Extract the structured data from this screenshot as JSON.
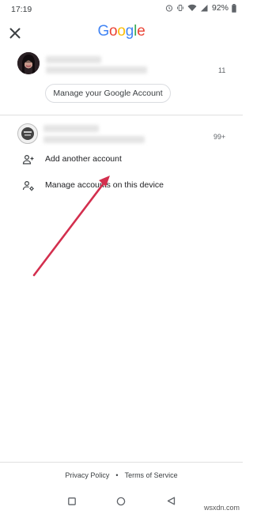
{
  "status_bar": {
    "time": "17:19",
    "battery": "92%"
  },
  "header": {
    "logo": [
      "G",
      "o",
      "o",
      "g",
      "l",
      "e"
    ],
    "logo_colors": [
      "#4285F4",
      "#EA4335",
      "#FBBC05",
      "#4285F4",
      "#34A853",
      "#EA4335"
    ]
  },
  "account_primary": {
    "count": "11",
    "manage_label": "Manage your Google Account"
  },
  "account_secondary": {
    "count": "99+"
  },
  "menu": {
    "add_account": "Add another account",
    "manage_accounts": "Manage accounts on this device"
  },
  "footer": {
    "privacy": "Privacy Policy",
    "separator": "•",
    "terms": "Terms of Service"
  },
  "watermark": "wsxdn.com",
  "colors": {
    "annotation_arrow": "#d32f4e"
  }
}
